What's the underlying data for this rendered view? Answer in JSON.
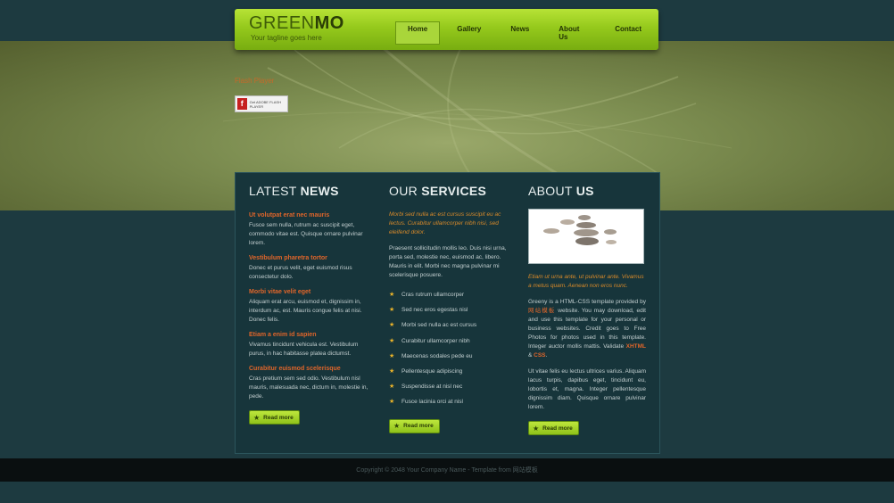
{
  "colors": {
    "accent_green": "#95c91c",
    "highlight_orange": "#e0652a",
    "panel_bg": "#17353b"
  },
  "header": {
    "logo_light": "GREEN",
    "logo_bold": "MO",
    "tagline": "Your tagline goes here",
    "nav": [
      "Home",
      "Gallery",
      "News",
      "About Us",
      "Contact"
    ],
    "active_nav": "Home"
  },
  "hero": {
    "flash_title": "Flash Player",
    "flash_badge": "Get ADOBE FLASH PLAYER"
  },
  "news": {
    "heading_light": "LATEST",
    "heading_bold": "NEWS",
    "items": [
      {
        "title": "Ut volutpat erat nec mauris",
        "body": "Fusce sem nulla, rutrum ac suscipit eget, commodo vitae est. Quisque ornare pulvinar lorem."
      },
      {
        "title": "Vestibulum pharetra tortor",
        "body": "Donec et purus velit, eget euismod risus consectetur dolo."
      },
      {
        "title": "Morbi vitae velit eget",
        "body": "Aliquam erat arcu, euismod et, dignissim in, interdum ac, est. Mauris congue felis at nisi. Donec felis."
      },
      {
        "title": "Etiam a enim id sapien",
        "body": "Vivamus tincidunt vehicula est. Vestibulum purus, in hac habitasse platea dictumst."
      },
      {
        "title": "Curabitur euismod scelerisque",
        "body": "Cras pretium sem sed odio. Vestibulum nisl mauris, malesuada nec, dictum in, molestie in, pede."
      }
    ],
    "read_more": "Read more"
  },
  "services": {
    "heading_light": "OUR",
    "heading_bold": "SERVICES",
    "intro": "Morbi sed nulla ac est cursus suscipit eu ac lectus. Curabitur ullamcorper nibh nisi, sed eleifend dolor.",
    "body": "Praesent sollicitudin mollis leo. Duis nisi urna, porta sed, molestie nec, euismod ac, libero. Mauris in elit. Morbi nec magna pulvinar mi scelerisque posuere.",
    "list": [
      "Cras rutrum ullamcorper",
      "Sed nec eros egestas nisl",
      "Morbi sed nulla ac est cursus",
      "Curabitur ullamcorper nibh",
      "Maecenas sodales pede eu",
      "Pellentesque adipiscing",
      "Suspendisse at nisl nec",
      "Fusce lacinia orci at nisl"
    ],
    "read_more": "Read more"
  },
  "about": {
    "heading_light": "ABOUT",
    "heading_bold": "US",
    "intro": "Etiam ut urna ante, ut pulvinar ante. Vivamus a metus quam. Aenean non eros nunc.",
    "p1_before": "Greeny is a HTML-CSS template provided by",
    "p1_link": "网站模板",
    "p1_after": "website. You may download, edit and use this template for your personal or business websites. Credit goes to Free Photos for photos used in this template. Integer auctor mollis mattis. Validate",
    "p1_xhtml": "XHTML",
    "p1_amp": "&",
    "p1_css": "CSS",
    "p1_end": ".",
    "p2": "Ut vitae felis eu lectus ultrices varius. Aliquam lacus turpis, dapibus eget, tincidunt eu, lobortis et, magna. Integer pellentesque dignissim diam. Quisque ornare pulvinar lorem.",
    "read_more": "Read more"
  },
  "footer": {
    "copyright": "Copyright © 2048 Your Company Name - Template from 网站模板"
  }
}
